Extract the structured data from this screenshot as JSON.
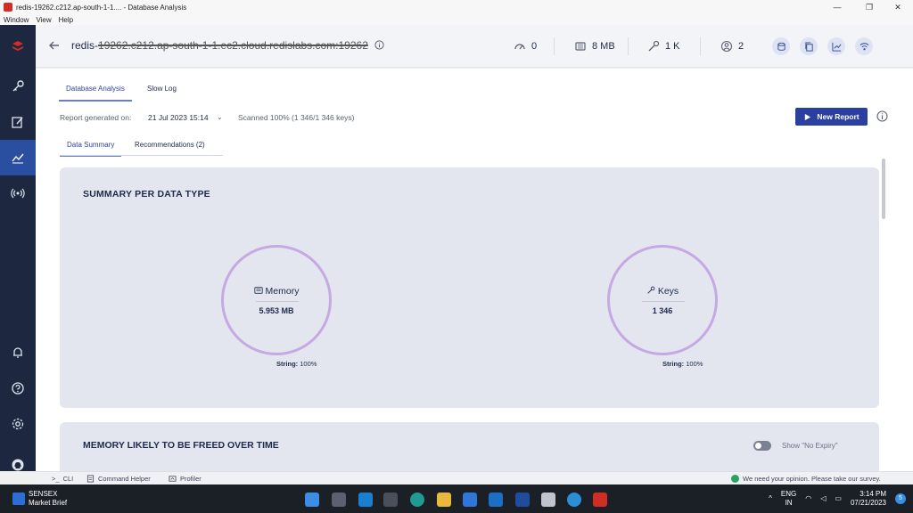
{
  "window": {
    "title": "redis-19262.c212.ap-south-1-1.... - Database Analysis",
    "menu": [
      "Window",
      "View",
      "Help"
    ]
  },
  "header": {
    "db_prefix": "redis-",
    "db_masked": "19262.c212.ap-south-1-1.ec2.cloud.redislabs.com:19262",
    "stats": {
      "cpu": "0",
      "memory": "8 MB",
      "keys": "1 K",
      "clients": "2"
    }
  },
  "tabs": {
    "database_analysis": "Database Analysis",
    "slow_log": "Slow Log"
  },
  "report": {
    "generated_label": "Report generated on:",
    "date": "21 Jul 2023 15:14",
    "scanned": "Scanned 100% (1 346/1 346 keys)",
    "new_report": "New Report"
  },
  "subtabs": {
    "data_summary": "Data Summary",
    "recommendations": "Recommendations (2)"
  },
  "summary": {
    "title": "SUMMARY PER DATA TYPE",
    "memory": {
      "label": "Memory",
      "value": "5.953 MB",
      "type": "String:",
      "percent": "100%"
    },
    "keys": {
      "label": "Keys",
      "value": "1 346",
      "type": "String:",
      "percent": "100%"
    }
  },
  "memory_freed": {
    "title": "MEMORY LIKELY TO BE FREED OVER TIME",
    "toggle_label": "Show \"No Expiry\""
  },
  "bottom": {
    "cli": "CLI",
    "command_helper": "Command Helper",
    "profiler": "Profiler",
    "survey": "We need your opinion. Please take our survey."
  },
  "taskbar": {
    "widget_title": "SENSEX",
    "widget_sub": "Market Brief",
    "lang": "ENG",
    "region": "IN",
    "time": "3:14 PM",
    "date": "07/21/2023",
    "notif": "5"
  },
  "colors": {
    "accent": "#2a3fa0",
    "nav_bg": "#1d2740",
    "nav_active": "#2b4fa0",
    "donut": "#c6a8e3",
    "card_bg": "#e3e6ef"
  }
}
